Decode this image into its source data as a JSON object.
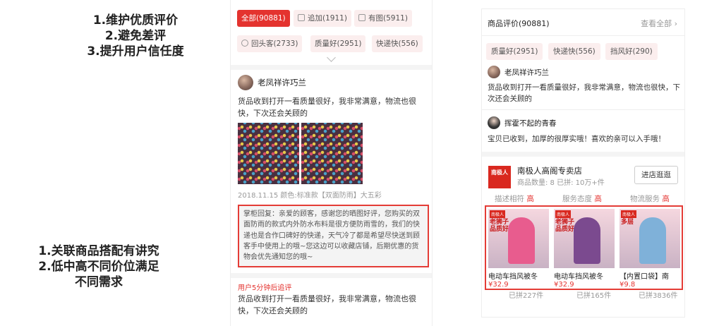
{
  "notes_top": [
    "1.维护优质评价",
    "2.避免差评",
    "3.提升用户信任度"
  ],
  "notes_bottom": [
    "1.关联商品搭配有讲究",
    "2.低中高不同价位满足",
    "不同需求"
  ],
  "colors": {
    "accent": "#e4332f",
    "tag_bg": "#fbeeee",
    "highlight_border": "#e43c36"
  },
  "mid": {
    "tags": [
      "全部(90881)",
      "追加(1911)",
      "有图(5911)",
      "回头客(2733)",
      "质量好(2951)",
      "快递快(556)"
    ],
    "reviewer": "老凤祥许巧兰",
    "review": "货品收到打开一看质量很好，我非常满意，物流也很快，下次还会关顾的",
    "meta": "2018.11.15  颜色:标准款【双面防雨】大五彩",
    "reply": "掌柜回复：亲爱的顾客，感谢您的晒图好评，您购买的双面防雨的款式内外防水布料是很方便防雨雪的，我们的快递也是合作口碑好的快递，天气冷了都是希望尽快送到顾客手中使用上的哦~您这边可以收藏店铺，后期优惠的货物会优先通知您的哦~",
    "followup_label": "用户5分钟后追评",
    "followup": "货品收到打开一看质量很好，我非常满意，物流也很快，下次还会关顾的"
  },
  "right": {
    "header": "商品评价(90881)",
    "view_all": "查看全部",
    "tags": [
      "质量好(2951)",
      "快递快(556)",
      "挡风好(290)"
    ],
    "reviews": [
      {
        "user": "老凤祥许巧兰",
        "text": "货品收到打开一看质量很好，我非常满意，物流也很快，下次还会关顾的"
      },
      {
        "user": "挥霍不起的青春",
        "text": "宝贝已收到，加厚的很厚实哦！喜欢的亲可以入手哦！"
      }
    ],
    "shop": {
      "logo": "南极人",
      "name": "南极人高阁专卖店",
      "stats": "商品数量: 8  已拼: 10万+件",
      "enter": "进店逛逛",
      "scores": [
        {
          "label": "描述相符",
          "level": "高"
        },
        {
          "label": "服务态度",
          "level": "高"
        },
        {
          "label": "物流服务",
          "level": "高"
        }
      ]
    },
    "products": [
      {
        "name": "电动车挡风被冬",
        "price": "¥32.9",
        "sold": "已拼227件",
        "promo": "老狮子品质好",
        "color": "#e85c8e"
      },
      {
        "name": "电动车挡风被冬",
        "price": "¥32.9",
        "sold": "已拼165件",
        "promo": "老狮子品质好",
        "color": "#7b4a8f"
      },
      {
        "name": "【内置口袋】南",
        "price": "¥9.8",
        "sold": "已拼3836件",
        "promo": "多层",
        "color": "#7fb1d9"
      }
    ]
  }
}
